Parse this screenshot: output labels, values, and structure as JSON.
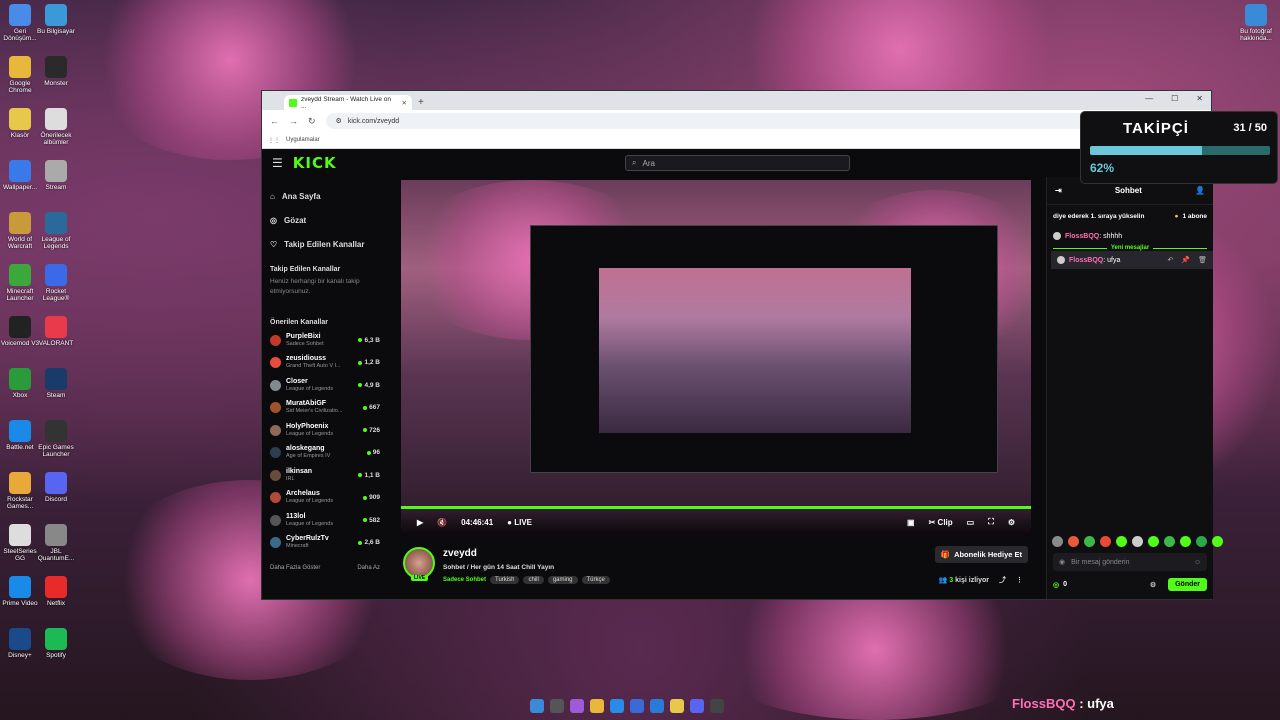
{
  "desktop": {
    "left_icons": [
      {
        "label": "Geri Dönüşüm..."
      },
      {
        "label": "Bu Bilgisayar"
      },
      {
        "label": "Google Chrome"
      },
      {
        "label": "Monster"
      },
      {
        "label": "Klasör"
      },
      {
        "label": "Önerilecek albümler"
      },
      {
        "label": "Wallpaper..."
      },
      {
        "label": "Stream"
      },
      {
        "label": "World of Warcraft"
      },
      {
        "label": "League of Legends"
      },
      {
        "label": "Minecraft Launcher"
      },
      {
        "label": "Rocket League®"
      },
      {
        "label": "Voicemod V3"
      },
      {
        "label": "VALORANT"
      },
      {
        "label": "Xbox"
      },
      {
        "label": "Steam"
      },
      {
        "label": "Battle.net"
      },
      {
        "label": "Epic Games Launcher"
      },
      {
        "label": "Rockstar Games..."
      },
      {
        "label": "Discord"
      },
      {
        "label": "SteelSeries GG"
      },
      {
        "label": "JBL QuantumE..."
      },
      {
        "label": "Prime Video"
      },
      {
        "label": "Netflix"
      },
      {
        "label": "Disney+"
      },
      {
        "label": "Spotify"
      }
    ],
    "right_icon": {
      "label": "Bu fotoğraf hakkında..."
    }
  },
  "browser": {
    "tab_title": "zveydd Stream - Watch Live on ...",
    "url": "kick.com/zveydd",
    "bookmarks_label": "Uygulamalar"
  },
  "kick": {
    "logo": "KICK",
    "search_placeholder": "Ara",
    "nav": [
      {
        "label": "Ana Sayfa",
        "icon": "home-icon"
      },
      {
        "label": "Gözat",
        "icon": "compass-icon"
      },
      {
        "label": "Takip Edilen Kanallar",
        "icon": "heart-icon"
      }
    ],
    "followed_heading": "Takip Edilen Kanallar",
    "followed_empty": "Henüz herhangi bir kanalı takip etmiyorsunuz.",
    "recommended_heading": "Önerilen Kanallar",
    "recommended": [
      {
        "name": "PurpleBixi",
        "game": "Sadece Sohbet",
        "viewers": "6,3 B",
        "color": "#c0392b"
      },
      {
        "name": "zeusidiouss",
        "game": "Grand Theft Auto V I...",
        "viewers": "1,2 B",
        "color": "#e74c3c"
      },
      {
        "name": "Closer",
        "game": "League of Legends",
        "viewers": "4,9 B",
        "color": "#7f8c8d"
      },
      {
        "name": "MuratAbiGF",
        "game": "Sid Meier's Civilizatio...",
        "viewers": "667",
        "color": "#a0522d"
      },
      {
        "name": "HolyPhoenix",
        "game": "League of Legends",
        "viewers": "726",
        "color": "#8e6a5a"
      },
      {
        "name": "aloskegang",
        "game": "Age of Empires IV",
        "viewers": "96",
        "color": "#2c3e50"
      },
      {
        "name": "ilkinsan",
        "game": "IRL",
        "viewers": "1,1 B",
        "color": "#6a4a3a"
      },
      {
        "name": "Archelaus",
        "game": "League of Legends",
        "viewers": "909",
        "color": "#b04a3a"
      },
      {
        "name": "113lol",
        "game": "League of Legends",
        "viewers": "582",
        "color": "#555"
      },
      {
        "name": "CyberRulzTv",
        "game": "Minecraft",
        "viewers": "2,6 B",
        "color": "#3a6a8a"
      }
    ],
    "show_more": "Daha Fazla Göster",
    "show_less": "Daha Az"
  },
  "player": {
    "time": "04:46:41",
    "live_label": "LIVE",
    "clip_label": "Clip"
  },
  "stream": {
    "streamer": "zveydd",
    "title": "Sohbet / Her gün 14 Saat Chill Yayın",
    "category": "Sadece Sohbet",
    "tags": [
      "Turkish",
      "chill",
      "gaming",
      "Türkçe"
    ],
    "live_badge": "LIVE",
    "sub_button": "Abonelik Hediye Et",
    "viewers_count": "3",
    "viewers_label": "kişi izliyor"
  },
  "chat": {
    "title": "Sohbet",
    "pinned_text": "diye ederek 1. sıraya yükselin",
    "pinned_right": "1 abone",
    "messages": [
      {
        "user": "FlossBQQ",
        "text": "shhhh"
      }
    ],
    "new_messages_label": "Yeni mesajlar",
    "highlighted": {
      "user": "FlossBQQ",
      "text": "ufya"
    },
    "input_placeholder": "Bir mesaj gönderin",
    "points": "0",
    "send_label": "Gönder"
  },
  "follower_goal": {
    "title": "TAKİPÇİ",
    "count": "31 / 50",
    "percent": "62%",
    "progress": 0.62
  },
  "notification": {
    "user": "FlossBQQ",
    "separator": " : ",
    "text": "ufya"
  },
  "colors": {
    "accent": "#53fc18",
    "username": "#ff6fb3",
    "goal": "#6ac8d8"
  }
}
